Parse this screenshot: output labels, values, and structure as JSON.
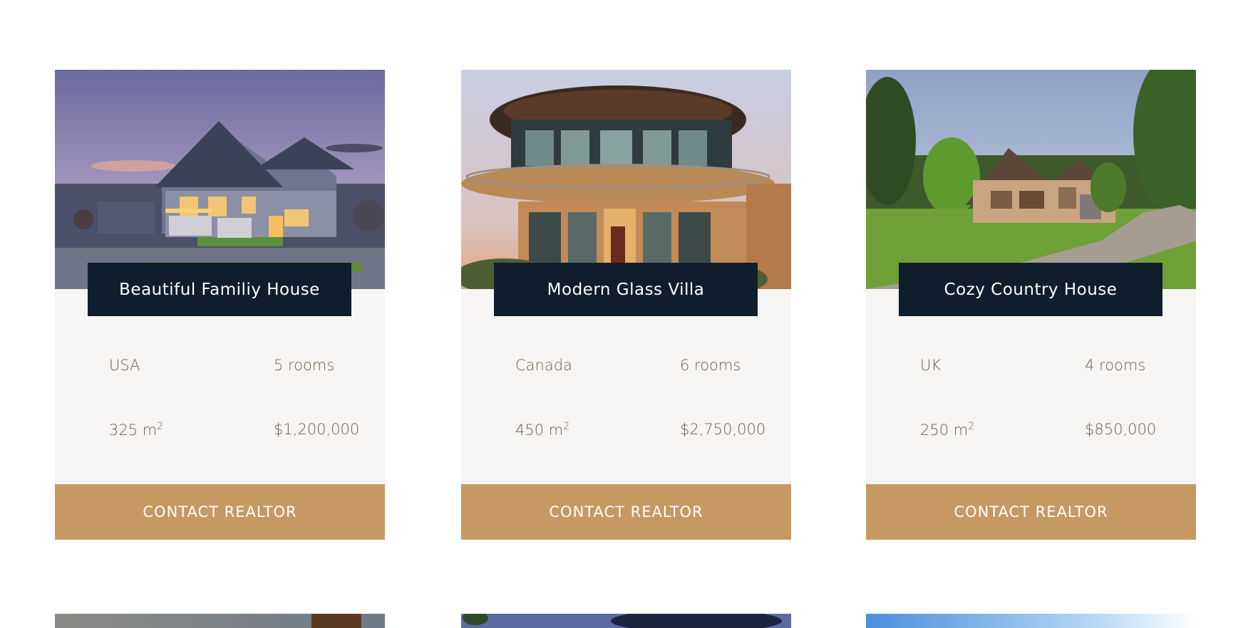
{
  "colors": {
    "title_bg": "#101d2c",
    "card_bg": "#f7f5f3",
    "button_bg": "#c69963",
    "text_muted": "#6d5d4b"
  },
  "cards": [
    {
      "title": "Beautiful Familiy House",
      "country": "USA",
      "rooms": "5 rooms",
      "area_value": "325 m",
      "area_sup": "2",
      "price": "$1,200,000",
      "button": "CONTACT REALTOR"
    },
    {
      "title": "Modern Glass Villa",
      "country": "Canada",
      "rooms": "6 rooms",
      "area_value": "450 m",
      "area_sup": "2",
      "price": "$2,750,000",
      "button": "CONTACT REALTOR"
    },
    {
      "title": "Cozy Country House",
      "country": "UK",
      "rooms": "4 rooms",
      "area_value": "250 m",
      "area_sup": "2",
      "price": "$850,000",
      "button": "CONTACT REALTOR"
    }
  ]
}
